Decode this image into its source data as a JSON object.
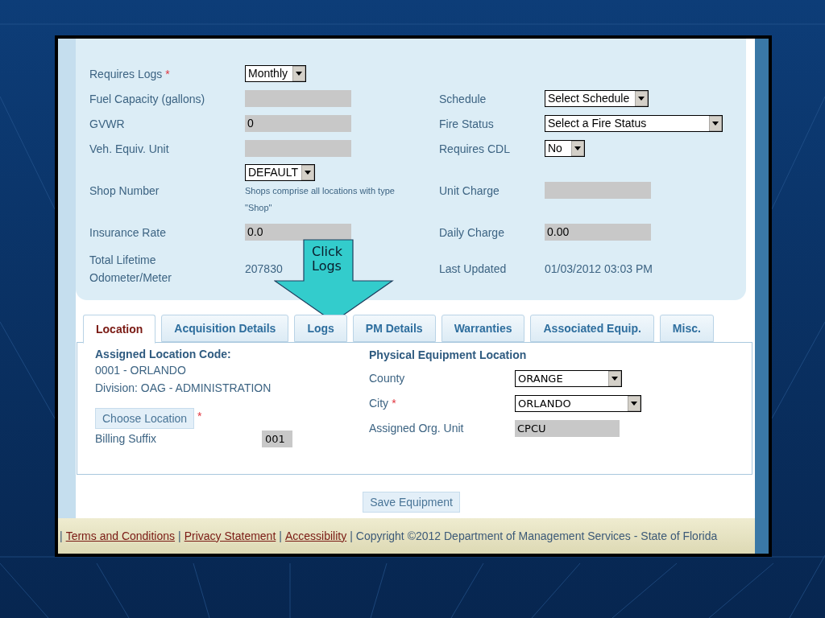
{
  "required_mark": "*",
  "form_rows": [
    {
      "left": {
        "label": "Requires Logs",
        "required": true,
        "control": {
          "kind": "select",
          "value": "Monthly"
        }
      },
      "right": null
    },
    {
      "left": {
        "label": "Fuel Capacity (gallons)",
        "required": false,
        "control": {
          "kind": "input"
        }
      },
      "right": {
        "label": "Schedule",
        "required": false,
        "control": {
          "kind": "select",
          "value": "Select Schedule"
        }
      }
    },
    {
      "left": {
        "label": "GVWR",
        "required": false,
        "control": {
          "kind": "input",
          "value": "0"
        }
      },
      "right": {
        "label": "Fire Status",
        "required": false,
        "control": {
          "kind": "select",
          "value": "Select a Fire Status"
        }
      }
    },
    {
      "left": {
        "label": "Veh. Equiv. Unit",
        "required": false,
        "control": {
          "kind": "input"
        }
      },
      "right": {
        "label": "Requires CDL",
        "required": false,
        "control": {
          "kind": "select",
          "value": "No"
        }
      }
    },
    {
      "left": {
        "label": "Shop Number",
        "required": false,
        "control": {
          "kind": "select",
          "value": "DEFAULT",
          "note": "Shops comprise all locations with type \"Shop\""
        }
      },
      "right": {
        "label": "Unit Charge",
        "required": false,
        "control": {
          "kind": "input"
        }
      }
    },
    {
      "left": {
        "label": "Insurance Rate",
        "required": false,
        "control": {
          "kind": "input",
          "value": "0.0"
        }
      },
      "right": {
        "label": "Daily Charge",
        "required": false,
        "control": {
          "kind": "input",
          "value": "0.00"
        }
      }
    },
    {
      "left": {
        "label": "Total Lifetime Odometer/Meter",
        "required": false,
        "control": {
          "kind": "text",
          "value": "207830"
        }
      },
      "right": {
        "label": "Last Updated",
        "required": false,
        "control": {
          "kind": "text",
          "value": "01/03/2012 03:03 PM"
        }
      }
    }
  ],
  "tabs": [
    {
      "label": "Location",
      "selected": true
    },
    {
      "label": "Acquisition Details",
      "selected": false
    },
    {
      "label": "Logs",
      "selected": false
    },
    {
      "label": "PM Details",
      "selected": false
    },
    {
      "label": "Warranties",
      "selected": false
    },
    {
      "label": "Associated Equip.",
      "selected": false
    },
    {
      "label": "Misc.",
      "selected": false
    }
  ],
  "location": {
    "heading": "Assigned Location Code:",
    "lines": [
      "0001 - ORLANDO",
      "Division: OAG - ADMINISTRATION"
    ],
    "choose_button": "Choose Location",
    "choose_required": true,
    "billing_label": "Billing Suffix",
    "billing_value": "001",
    "physical_heading": "Physical Equipment Location",
    "physical_rows": [
      {
        "label": "County",
        "required": false,
        "kind": "select",
        "value": "ORANGE"
      },
      {
        "label": "City",
        "required": true,
        "kind": "select",
        "value": "ORLANDO"
      },
      {
        "label": "Assigned Org. Unit",
        "required": false,
        "kind": "input",
        "value": "CPCU"
      }
    ]
  },
  "save_button": "Save Equipment",
  "footer": {
    "separator": "|",
    "items": [
      {
        "kind": "link",
        "text": "Terms and Conditions"
      },
      {
        "kind": "link",
        "text": "Privacy Statement"
      },
      {
        "kind": "link",
        "text": "Accessibility"
      },
      {
        "kind": "text",
        "text": "Copyright ©2012 Department of Management Services - State of Florida"
      }
    ]
  },
  "callout": {
    "text": "Click\nLogs"
  }
}
